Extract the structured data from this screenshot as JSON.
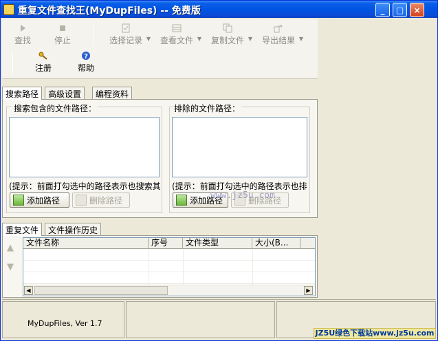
{
  "window": {
    "title": "重复文件查找王(MyDupFiles) -- 免费版",
    "controls": {
      "minimize": "_",
      "maximize": "□",
      "close": "×"
    }
  },
  "toolbar": {
    "row1": [
      {
        "label": "查找",
        "icon": "play-icon"
      },
      {
        "label": "停止",
        "icon": "stop-icon"
      },
      {
        "label": "选择记录",
        "icon": "checklist-icon"
      },
      {
        "label": "查看文件",
        "icon": "table-icon"
      },
      {
        "label": "复制文件",
        "icon": "copy-icon"
      },
      {
        "label": "导出结果",
        "icon": "export-icon"
      }
    ],
    "row2": [
      {
        "label": "注册",
        "icon": "key-icon"
      },
      {
        "label": "帮助",
        "icon": "help-icon"
      }
    ]
  },
  "search_tabs": [
    "搜索路径",
    "高级设置",
    "编程资料"
  ],
  "search_panel": {
    "include": {
      "label": "搜索包含的文件路径：",
      "hint": "(提示：前面打勾选中的路径表示也搜索其",
      "add_button": "添加路径",
      "remove_button": "删除路径"
    },
    "exclude": {
      "label": "排除的文件路径：",
      "hint": "(提示：前面打勾选中的路径表示也排",
      "add_button": "添加路径",
      "remove_button": "删除路径"
    },
    "watermark": "www.jz5u.com"
  },
  "result_tabs": [
    "重复文件",
    "文件操作历史"
  ],
  "results_table": {
    "columns": [
      "文件名称",
      "序号",
      "文件类型",
      "大小(B..."
    ],
    "rows": []
  },
  "status": {
    "version": "MyDupFiles, Ver 1.7"
  },
  "banner": "JZ5U绿色下载站www.jz5u.com"
}
